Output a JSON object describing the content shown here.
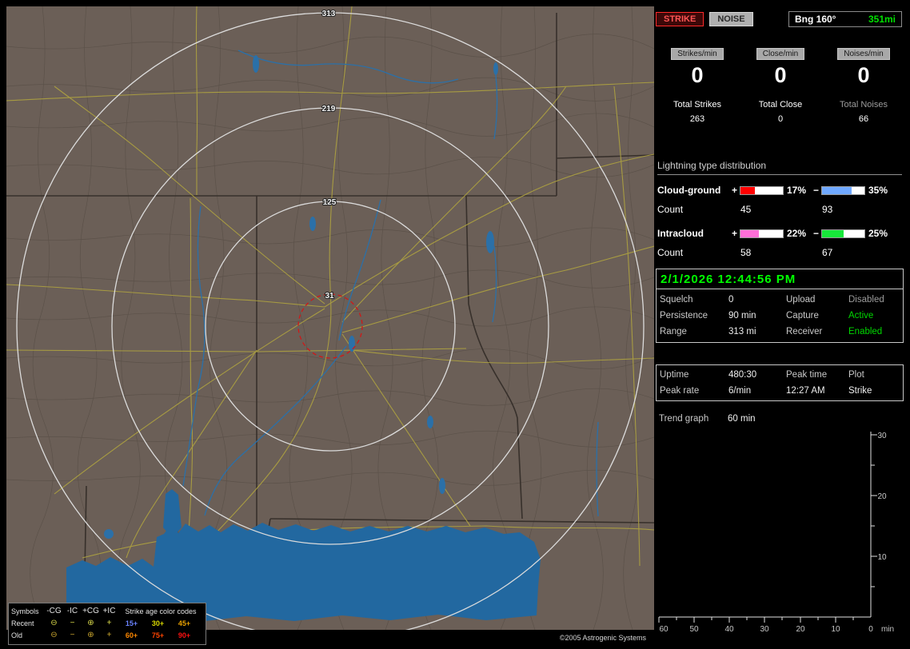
{
  "map": {
    "ring_labels": [
      "313",
      "219",
      "125",
      "31"
    ],
    "copyright": "©2005 Astrogenic Systems",
    "legend": {
      "symbols_header": "Symbols",
      "symbol_cols": [
        "-CG",
        "-IC",
        "+CG",
        "+IC"
      ],
      "age_header": "Strike age color codes",
      "rows": [
        {
          "label": "Recent",
          "symbols": [
            {
              "glyph": "⊖",
              "style": "color:#d8d84a"
            },
            {
              "glyph": "−",
              "style": "color:#d8d84a"
            },
            {
              "glyph": "⊕",
              "style": "color:#d8d84a"
            },
            {
              "glyph": "+",
              "style": "color:#d8d84a"
            }
          ],
          "ages": [
            {
              "text": "15+",
              "style": "color:#6b83ff"
            },
            {
              "text": "30+",
              "style": "color:#d8d800"
            },
            {
              "text": "45+",
              "style": "color:#e8a000"
            }
          ]
        },
        {
          "label": "Old",
          "symbols": [
            {
              "glyph": "⊖",
              "style": "color:#c9a52e"
            },
            {
              "glyph": "−",
              "style": "color:#c9a52e"
            },
            {
              "glyph": "⊕",
              "style": "color:#c9a52e"
            },
            {
              "glyph": "+",
              "style": "color:#c9a52e"
            }
          ],
          "ages": [
            {
              "text": "60+",
              "style": "color:#ff8800"
            },
            {
              "text": "75+",
              "style": "color:#ff4400"
            },
            {
              "text": "90+",
              "style": "color:#ff1111"
            }
          ]
        }
      ]
    }
  },
  "panel": {
    "strike_button": "STRIKE",
    "noise_button": "NOISE",
    "bearing_label": "Bng 160°",
    "bearing_value": "351mi",
    "rates": [
      {
        "chip": "Strikes/min",
        "value": "0",
        "total_label": "Total Strikes",
        "total_value": "263",
        "total_label_style": "color:#ffffff"
      },
      {
        "chip": "Close/min",
        "value": "0",
        "total_label": "Total Close",
        "total_value": "0",
        "total_label_style": "color:#ffffff"
      },
      {
        "chip": "Noises/min",
        "value": "0",
        "total_label": "Total Noises",
        "total_value": "66",
        "total_label_style": "color:#9c9c9c"
      }
    ],
    "distribution": {
      "title": "Lightning type distribution",
      "plus": "+",
      "minus": "−",
      "count_label": "Count",
      "rows": [
        {
          "label": "Cloud-ground",
          "pos_pct": "17%",
          "neg_pct": "35%",
          "pos_count": "45",
          "neg_count": "93",
          "pos_fill_style": "width:34%;background:#ff0000",
          "neg_fill_style": "width:70%;background:#6fa8ff"
        },
        {
          "label": "Intracloud",
          "pos_pct": "22%",
          "neg_pct": "25%",
          "pos_count": "58",
          "neg_count": "67",
          "pos_fill_style": "width:44%;background:#ff6fd8",
          "neg_fill_style": "width:50%;background:#17e83a"
        }
      ]
    },
    "datetime": "2/1/2026 12:44:56 PM",
    "settings": [
      {
        "label": "Squelch",
        "value": "0",
        "value_style": "color:#ececec",
        "label2": "Upload",
        "value2": "Disabled",
        "value2_style": "color:#9c9c9c"
      },
      {
        "label": "Persistence",
        "value": "90 min",
        "value_style": "color:#ececec",
        "label2": "Capture",
        "value2": "Active",
        "value2_style": "color:#00d800"
      },
      {
        "label": "Range",
        "value": "313 mi",
        "value_style": "color:#ececec",
        "label2": "Receiver",
        "value2": "Enabled",
        "value2_style": "color:#00d800"
      }
    ],
    "status": {
      "uptime_label": "Uptime",
      "uptime_value": "480:30",
      "peak_time_label": "Peak time",
      "plot_label": "Plot",
      "peak_rate_label": "Peak rate",
      "peak_rate_value": "6/min",
      "peak_time_value": "12:27 AM",
      "plot_value": "Strike"
    }
  },
  "chart_data": {
    "type": "line",
    "title": "Trend graph",
    "window_label": "60 min",
    "xlabel": "min",
    "x_tick_labels": [
      "60",
      "50",
      "40",
      "30",
      "20",
      "10",
      "0"
    ],
    "y_tick_labels": [
      "30",
      "20",
      "10"
    ],
    "xlim": [
      60,
      0
    ],
    "ylim": [
      0,
      30
    ],
    "series": [
      {
        "name": "Strike",
        "x": [],
        "values": []
      }
    ],
    "note": "trend plot area is empty — 0 strikes/min during the displayed window"
  }
}
